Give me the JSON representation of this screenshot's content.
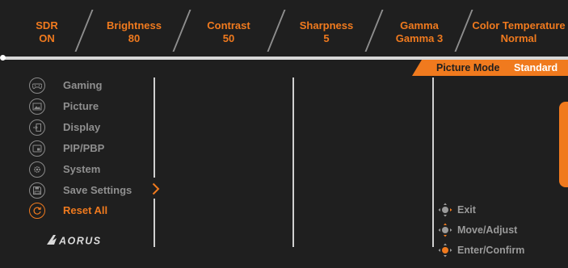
{
  "status_bar": [
    {
      "name": "SDR",
      "value": "ON"
    },
    {
      "name": "Brightness",
      "value": "80"
    },
    {
      "name": "Contrast",
      "value": "50"
    },
    {
      "name": "Sharpness",
      "value": "5"
    },
    {
      "name": "Gamma",
      "value": "Gamma 3"
    },
    {
      "name": "Color Temperature",
      "value": "Normal"
    }
  ],
  "picture_mode": {
    "label": "Picture Mode",
    "value": "Standard"
  },
  "menu": {
    "items": [
      {
        "label": "Gaming",
        "icon": "gamepad-icon"
      },
      {
        "label": "Picture",
        "icon": "picture-icon"
      },
      {
        "label": "Display",
        "icon": "display-input-icon"
      },
      {
        "label": "PIP/PBP",
        "icon": "pip-pbp-icon"
      },
      {
        "label": "System",
        "icon": "gear-icon"
      },
      {
        "label": "Save Settings",
        "icon": "save-icon"
      },
      {
        "label": "Reset All",
        "icon": "reset-icon",
        "selected": true
      }
    ]
  },
  "brand": {
    "logo_text": "AORUS"
  },
  "hints": [
    {
      "label": "Exit",
      "icon": "joystick-icon"
    },
    {
      "label": "Move/Adjust",
      "icon": "joystick-icon"
    },
    {
      "label": "Enter/Confirm",
      "icon": "joystick-icon"
    }
  ],
  "colors": {
    "accent": "#f07a1e",
    "background": "#1f1f1f",
    "text_dim": "#8f8f8f",
    "divider": "#d8d8d8"
  }
}
